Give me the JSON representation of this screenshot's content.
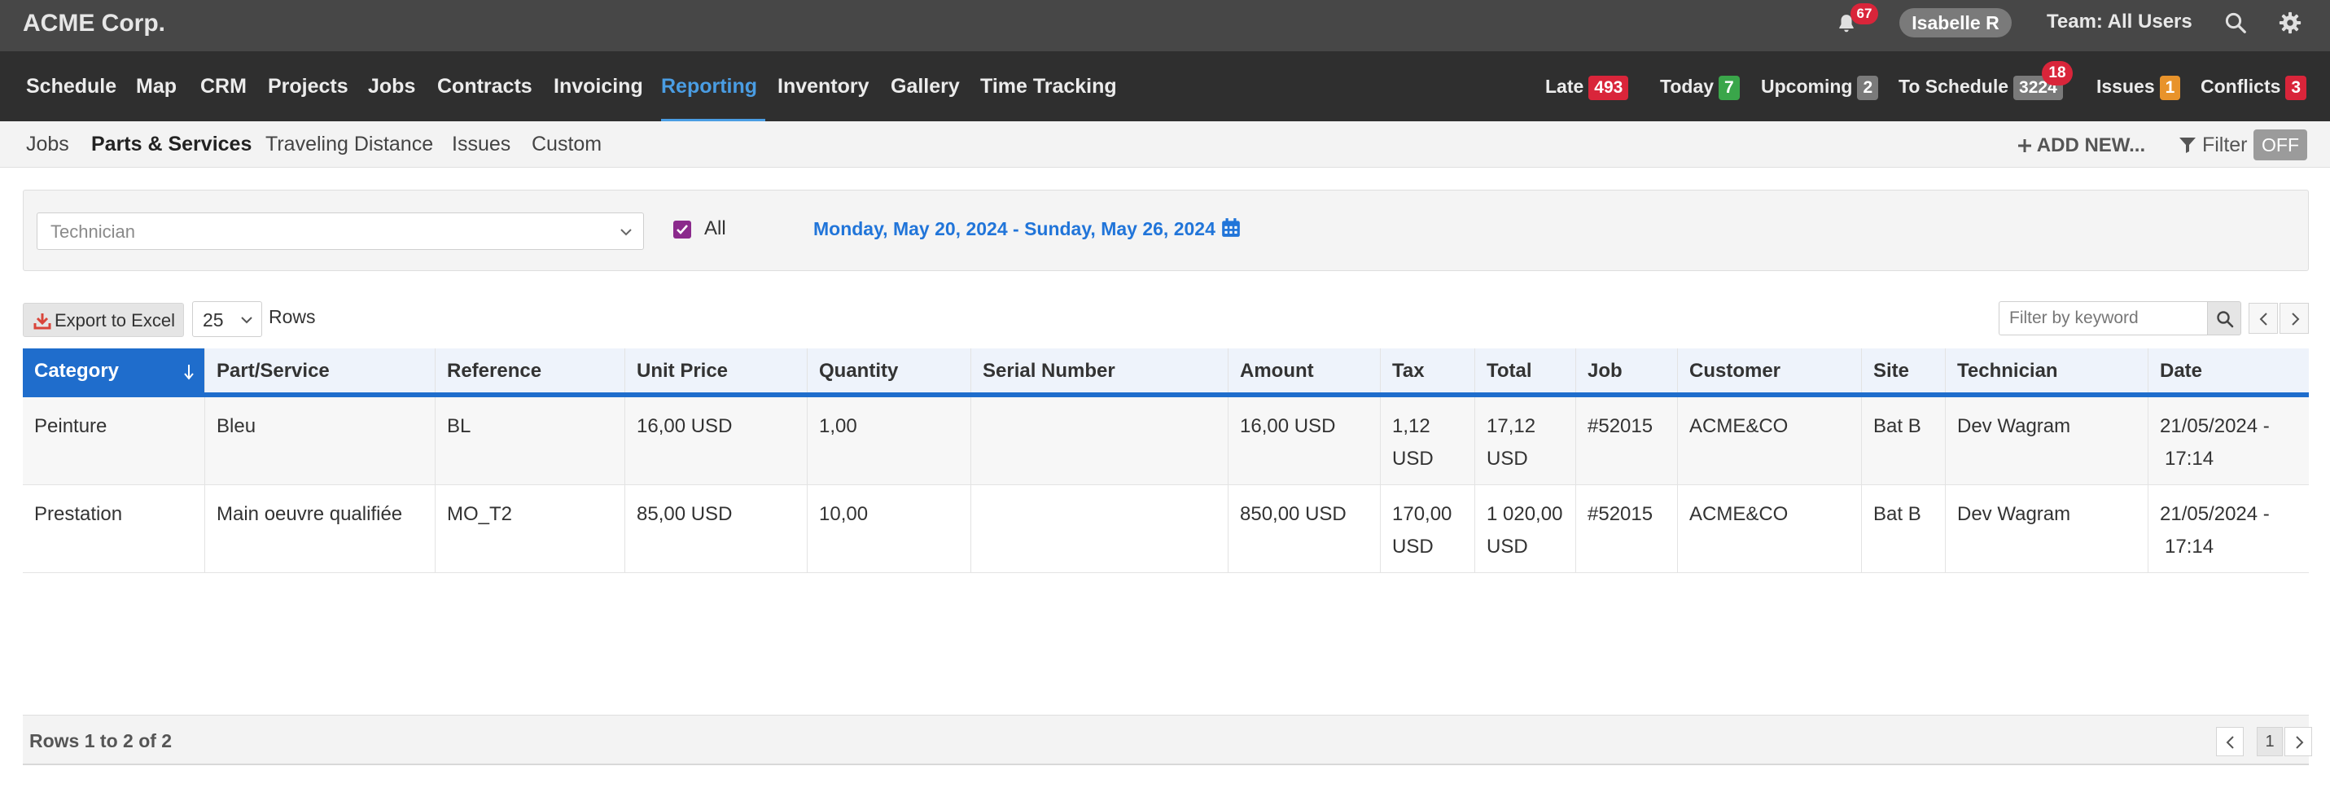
{
  "app": {
    "brand": "ACME Corp.",
    "notifications_count": "67",
    "user_name": "Isabelle R",
    "team_label": "Team: All Users"
  },
  "nav": {
    "items": [
      "Schedule",
      "Map",
      "CRM",
      "Projects",
      "Jobs",
      "Contracts",
      "Invoicing",
      "Reporting",
      "Inventory",
      "Gallery",
      "Time Tracking"
    ],
    "active": "Reporting"
  },
  "stats": [
    {
      "label": "Late",
      "count": "493",
      "color": "#d9253a"
    },
    {
      "label": "Today",
      "count": "7",
      "color": "#3aa64a"
    },
    {
      "label": "Upcoming",
      "count": "2",
      "color": "#7a7a7a"
    },
    {
      "label": "To Schedule",
      "count": "3224",
      "badge": "18",
      "color": "#7a7a7a"
    },
    {
      "label": "Issues",
      "count": "1",
      "color": "#e8932b"
    },
    {
      "label": "Conflicts",
      "count": "3",
      "color": "#d9253a"
    }
  ],
  "subnav": {
    "items": [
      "Jobs",
      "Parts & Services",
      "Traveling Distance",
      "Issues",
      "Custom"
    ],
    "active": "Parts & Services",
    "add_new": "ADD NEW...",
    "filter_label": "Filter",
    "filter_state": "OFF"
  },
  "filters": {
    "technician_placeholder": "Technician",
    "all_label": "All",
    "all_checked": true,
    "date_range": "Monday, May 20, 2024 - Sunday, May 26, 2024"
  },
  "toolbar": {
    "export_label": "Export to Excel",
    "rows_value": "25",
    "rows_label": "Rows",
    "keyword_placeholder": "Filter by keyword"
  },
  "table": {
    "columns": [
      "Category",
      "Part/Service",
      "Reference",
      "Unit Price",
      "Quantity",
      "Serial Number",
      "Amount",
      "Tax",
      "Total",
      "Job",
      "Customer",
      "Site",
      "Technician",
      "Date"
    ],
    "sorted_column": "Category",
    "rows": [
      {
        "category": "Peinture",
        "part": "Bleu",
        "reference": "BL",
        "unit_price": "16,00 USD",
        "quantity": "1,00",
        "serial": "",
        "amount": "16,00 USD",
        "tax": [
          "1,12",
          "USD"
        ],
        "total": [
          "17,12",
          "USD"
        ],
        "job": "#52015",
        "customer": "ACME&CO",
        "site": "Bat B",
        "technician": "Dev Wagram",
        "date": [
          "21/05/2024 -",
          "17:14"
        ]
      },
      {
        "category": "Prestation",
        "part": "Main oeuvre qualifiée",
        "reference": "MO_T2",
        "unit_price": "85,00 USD",
        "quantity": "10,00",
        "serial": "",
        "amount": "850,00 USD",
        "tax": [
          "170,00",
          "USD"
        ],
        "total": [
          "1 020,00",
          "USD"
        ],
        "job": "#52015",
        "customer": "ACME&CO",
        "site": "Bat B",
        "technician": "Dev Wagram",
        "date": [
          "21/05/2024 -",
          "17:14"
        ]
      }
    ]
  },
  "footer": {
    "rows_info": "Rows 1 to 2 of 2",
    "current_page": "1"
  }
}
